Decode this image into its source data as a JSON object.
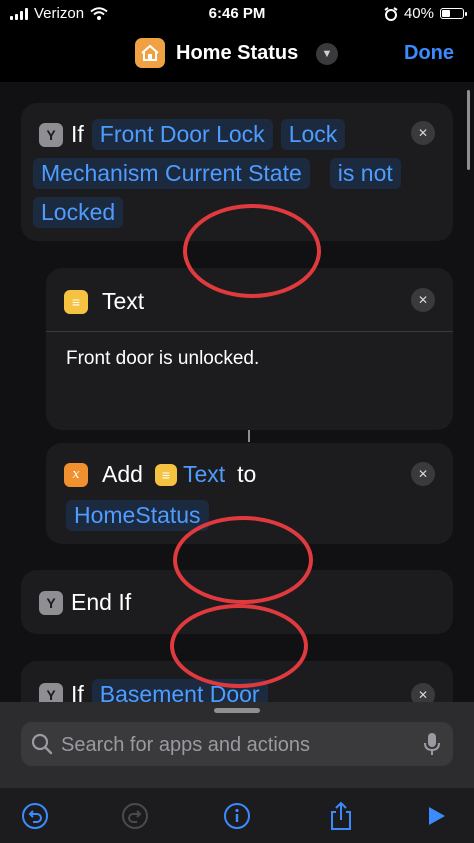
{
  "status_bar": {
    "carrier": "Verizon",
    "time": "6:46 PM",
    "battery": "40%",
    "battery_level": 0.4
  },
  "nav": {
    "title": "Home Status",
    "done": "Done"
  },
  "actions": [
    {
      "keyword": "If",
      "tokens": [
        "Front Door Lock",
        "Lock",
        "Mechanism Current State",
        "is not",
        "Locked"
      ]
    },
    {
      "title": "Text",
      "body": "Front door is unlocked."
    },
    {
      "keyword": "Add",
      "token_text": "Text",
      "to": "to",
      "variable": "HomeStatus"
    },
    {
      "keyword": "End If"
    },
    {
      "keyword": "If",
      "tokens": [
        "Basement Door"
      ]
    }
  ],
  "search": {
    "placeholder": "Search for apps and actions"
  },
  "toolbar": {
    "icons": [
      "undo-icon",
      "redo-icon",
      "info-icon",
      "share-icon",
      "play-icon"
    ]
  },
  "colors": {
    "accent": "#3b8bff",
    "annotation": "#e03a3f",
    "card": "#1c1c1e"
  }
}
